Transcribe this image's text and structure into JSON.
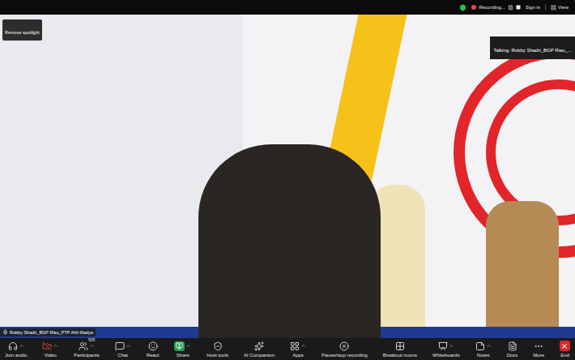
{
  "top_bar": {
    "recording_status": "Recording...",
    "sign_in": "Sign in",
    "view": "View"
  },
  "video": {
    "spotlight_button": "Remove spotlight",
    "talking": "Talking: Robby Shadri_BGP Riau_...",
    "name_label": "Robby Shadri_BGP Riau_PTP Ahli Madya",
    "mic_muted": false
  },
  "toolbar": [
    {
      "label": "Join audio",
      "kind": "button",
      "has_menu": true,
      "off": false
    },
    {
      "label": "Video",
      "kind": "button",
      "has_menu": true,
      "off": true
    },
    {
      "label": "Participants",
      "kind": "button",
      "has_menu": true,
      "off": false,
      "badge": "505"
    },
    {
      "label": "Chat",
      "kind": "button",
      "has_menu": true,
      "off": false
    },
    {
      "label": "React",
      "kind": "button",
      "has_menu": false,
      "off": false
    },
    {
      "label": "Share",
      "kind": "share",
      "has_menu": true,
      "off": false
    },
    {
      "label": "Host tools",
      "kind": "button",
      "has_menu": false,
      "off": false
    },
    {
      "label": "AI Companion",
      "kind": "button",
      "has_menu": false,
      "off": false
    },
    {
      "label": "Apps",
      "kind": "button",
      "has_menu": true,
      "off": false
    },
    {
      "label": "Pause/stop recording",
      "kind": "button",
      "has_menu": false,
      "off": false
    },
    {
      "label": "Breakout rooms",
      "kind": "button",
      "has_menu": false,
      "off": false
    },
    {
      "label": "Whiteboards",
      "kind": "button",
      "has_menu": true,
      "off": false
    },
    {
      "label": "Notes",
      "kind": "button",
      "has_menu": true,
      "off": false
    },
    {
      "label": "Docs",
      "kind": "button",
      "has_menu": false,
      "off": false
    },
    {
      "label": "More",
      "kind": "button",
      "has_menu": false,
      "off": false
    },
    {
      "label": "End",
      "kind": "end",
      "has_menu": false,
      "off": false
    }
  ]
}
